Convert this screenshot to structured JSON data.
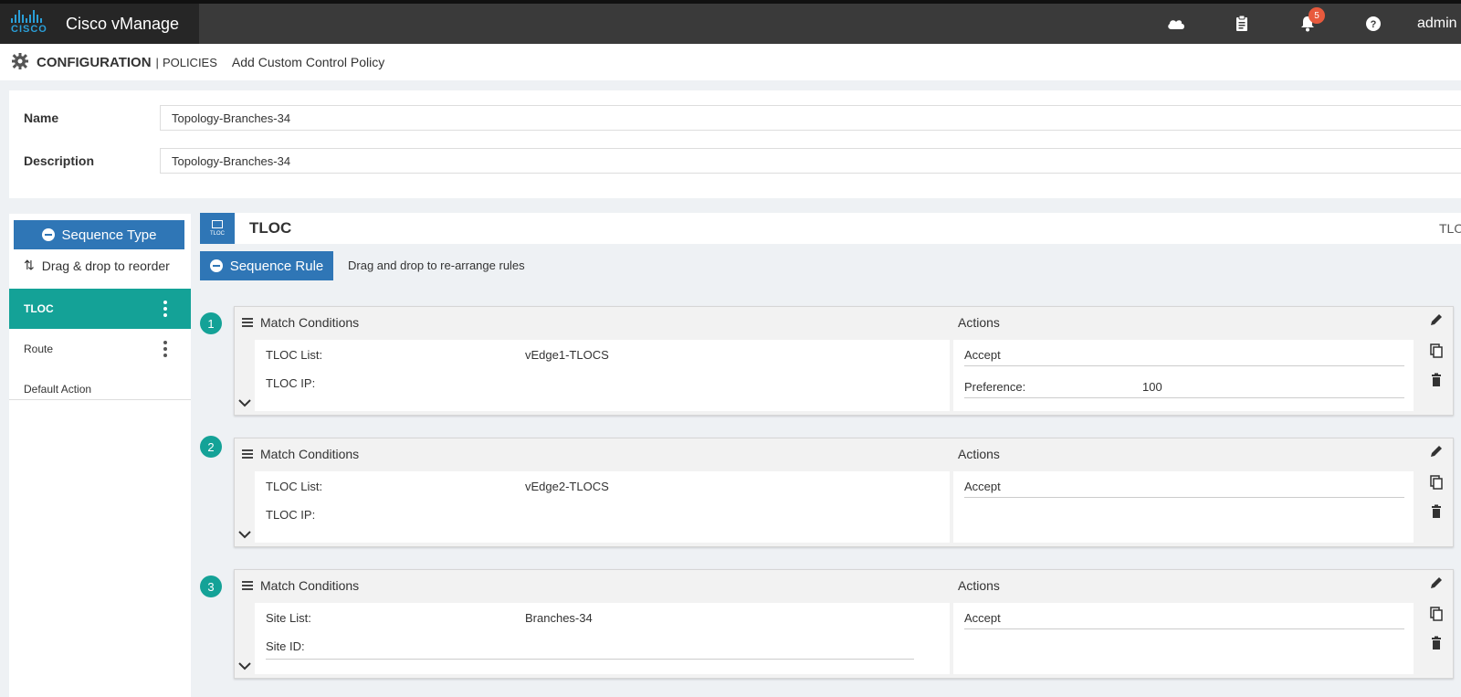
{
  "app": {
    "brand_word": "CISCO",
    "title": "Cisco vManage",
    "notification_count": "5",
    "user": "admin"
  },
  "header_icons": [
    "cloud-icon",
    "clipboard-icon",
    "bell-icon",
    "help-icon"
  ],
  "breadcrumb": {
    "section": "CONFIGURATION",
    "separator": "|",
    "subsection": "POLICIES",
    "page": "Add Custom Control Policy"
  },
  "form": {
    "name_label": "Name",
    "name_value": "Topology-Branches-34",
    "description_label": "Description",
    "description_value": "Topology-Branches-34"
  },
  "sidebar": {
    "sequence_type_label": "Sequence Type",
    "drag_hint": "Drag & drop to reorder",
    "items": [
      {
        "label": "TLOC",
        "active": true
      },
      {
        "label": "Route",
        "active": false
      },
      {
        "label": "Default Action",
        "active": false
      }
    ]
  },
  "main": {
    "icon_caption": "TLOC",
    "title": "TLOC",
    "right_label": "TLOC",
    "sequence_rule_label": "Sequence Rule",
    "rule_hint": "Drag and drop to re-arrange rules"
  },
  "rules": [
    {
      "number": "1",
      "match_title": "Match Conditions",
      "actions_title": "Actions",
      "conditions": [
        {
          "label": "TLOC List:",
          "value": "vEdge1-TLOCS"
        },
        {
          "label": "TLOC IP:",
          "value": ""
        }
      ],
      "actions": [
        {
          "label": "Accept",
          "value": ""
        },
        {
          "label": "Preference:",
          "value": "100"
        }
      ]
    },
    {
      "number": "2",
      "match_title": "Match Conditions",
      "actions_title": "Actions",
      "conditions": [
        {
          "label": "TLOC List:",
          "value": "vEdge2-TLOCS"
        },
        {
          "label": "TLOC IP:",
          "value": ""
        }
      ],
      "actions": [
        {
          "label": "Accept",
          "value": ""
        }
      ]
    },
    {
      "number": "3",
      "match_title": "Match Conditions",
      "actions_title": "Actions",
      "conditions": [
        {
          "label": "Site List:",
          "value": "Branches-34"
        },
        {
          "label": "Site ID:",
          "value": ""
        }
      ],
      "actions": [
        {
          "label": "Accept",
          "value": ""
        }
      ]
    }
  ],
  "colors": {
    "primary": "#2f76b6",
    "teal": "#14a297",
    "topbar": "#3a3a3a",
    "badge": "#e85a3d"
  }
}
